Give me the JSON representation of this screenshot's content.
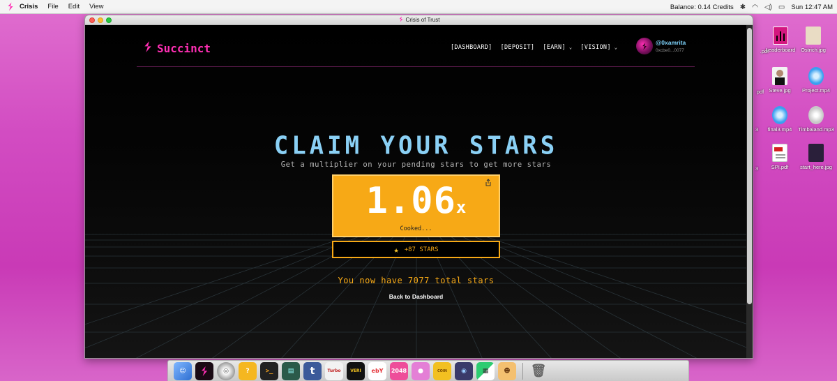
{
  "menubar": {
    "app_name": "Crisis",
    "menus": [
      "File",
      "Edit",
      "View"
    ],
    "balance": "Balance:  0.14 Credits",
    "clock": "Sun 12:47 AM"
  },
  "desktop_icons": [
    {
      "label": ".pdf",
      "icon": "pdf-file-icon"
    },
    {
      "label": "Leaderboard",
      "icon": "leaderboard-icon"
    },
    {
      "label": "Ostrich.jpg",
      "icon": "image-file-icon"
    },
    {
      "label": "pdf",
      "icon": "pdf-file-icon"
    },
    {
      "label": "Steve.jpg",
      "icon": "image-file-icon"
    },
    {
      "label": "Project.mp4",
      "icon": "quicktime-icon"
    },
    {
      "label": "3",
      "icon": "file-icon"
    },
    {
      "label": "final3.mp4",
      "icon": "quicktime-icon"
    },
    {
      "label": "Timbaland.mp3",
      "icon": "audio-file-icon"
    },
    {
      "label": "3",
      "icon": "file-icon"
    },
    {
      "label": "SPI.pdf",
      "icon": "pdf-file-icon"
    },
    {
      "label": "start_here.jpg",
      "icon": "image-file-icon"
    }
  ],
  "window": {
    "title": "Crisis of Trust"
  },
  "site": {
    "brand": "Succinct",
    "nav": [
      {
        "label": "[DASHBOARD]",
        "dropdown": false
      },
      {
        "label": "[DEPOSIT]",
        "dropdown": false
      },
      {
        "label": "[EARN]",
        "dropdown": true
      },
      {
        "label": "[VISION]",
        "dropdown": true
      }
    ],
    "user": {
      "handle": "@0xamrita",
      "address": "0xcbe0...0077"
    }
  },
  "hero": {
    "title": "CLAIM YOUR STARS",
    "subtitle": "Get a multiplier on your pending stars to get more stars",
    "multiplier": "1.06",
    "multiplier_suffix": "x",
    "status": "Cooked...",
    "stars_button": "+87 STARS",
    "total": "You now have 7077 total stars",
    "back_link": "Back to Dashboard"
  },
  "colors": {
    "accent_pink": "#ff2fb4",
    "title_blue": "#8ad0f5",
    "orange": "#f7a916",
    "desktop_pink": "#d24cc2"
  },
  "dock": [
    "finder-icon",
    "succinct-icon",
    "network-icon",
    "help-icon",
    "terminal-icon",
    "monitor-icon",
    "tumblr-icon",
    "game-icon",
    "verizon-star-icon",
    "ebay-icon",
    "2048-icon",
    "candy-icon",
    "coin-craze-icon",
    "monster-icon",
    "puzzle-icon",
    "pet-icon",
    "trash-icon"
  ]
}
